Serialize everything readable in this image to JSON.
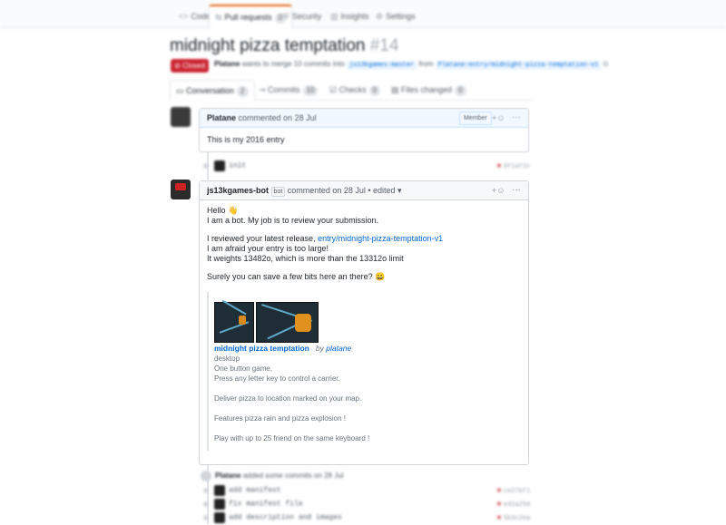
{
  "repo_tabs": [
    {
      "icon": "<>",
      "label": "Code",
      "count": ""
    },
    {
      "icon": "⇆",
      "label": "Pull requests",
      "count": "0"
    },
    {
      "icon": "⛨",
      "label": "Security",
      "count": ""
    },
    {
      "icon": "▥",
      "label": "Insights",
      "count": ""
    },
    {
      "icon": "⚙",
      "label": "Settings",
      "count": ""
    }
  ],
  "pr": {
    "title": "midnight pizza temptation",
    "number": "#14",
    "state": "Closed",
    "meta_author": "Platane",
    "meta_text": "wants to merge 10 commits into",
    "base_branch": "js13kgames:master",
    "from_word": "from",
    "head_branch": "Platane:entry/midnight-pizza-temptation-v1"
  },
  "pr_tabs": [
    {
      "label": "Conversation",
      "count": "2"
    },
    {
      "label": "Commits",
      "count": "10"
    },
    {
      "label": "Checks",
      "count": "0"
    },
    {
      "label": "Files changed",
      "count": "0"
    }
  ],
  "comment1": {
    "author": "Platane",
    "action": "commented on 28 Jul",
    "role": "Member",
    "body": "This is my 2016 entry"
  },
  "commit_init": {
    "message": "init",
    "sha": "0f1af2c"
  },
  "comment2": {
    "author": "js13kgames-bot",
    "bot_label": "bot",
    "action": "commented on 28 Jul • edited ▾",
    "line1": "Hello 👋",
    "line2": "I am a bot. My job is to review your submission.",
    "line3_pre": "I reviewed your latest release, ",
    "line3_link": "entry/midnight-pizza-temptation-v1",
    "line4": "I am afraid your entry is too large!",
    "line5": "It weights 13482o, which is more than the 13312o limit",
    "line6": "Surely you can save a few bits here an there? 😀",
    "game_title": "midnight pizza temptation",
    "game_by": "by",
    "game_author": "platane",
    "game_category": "desktop",
    "desc1": "One button game,",
    "desc2": "Press any letter key to control a carrier.",
    "desc3": "Deliver pizza to location marked on your map.",
    "desc4": "Features pizza rain and pizza explosion !",
    "desc5": "Play with up to 25 friend on the same keyboard !"
  },
  "later_event": {
    "author": "Platane",
    "text": "added some commits on 28 Jul"
  },
  "later_commits": [
    {
      "message": "add manifest",
      "sha": "ce27bf1"
    },
    {
      "message": "fix manifest file",
      "sha": "e42a25d"
    },
    {
      "message": "add description and images",
      "sha": "5b3c2ea"
    }
  ],
  "colors": {
    "closed": "#cb2431",
    "link": "#0366d6",
    "tab_accent": "#e36209"
  }
}
